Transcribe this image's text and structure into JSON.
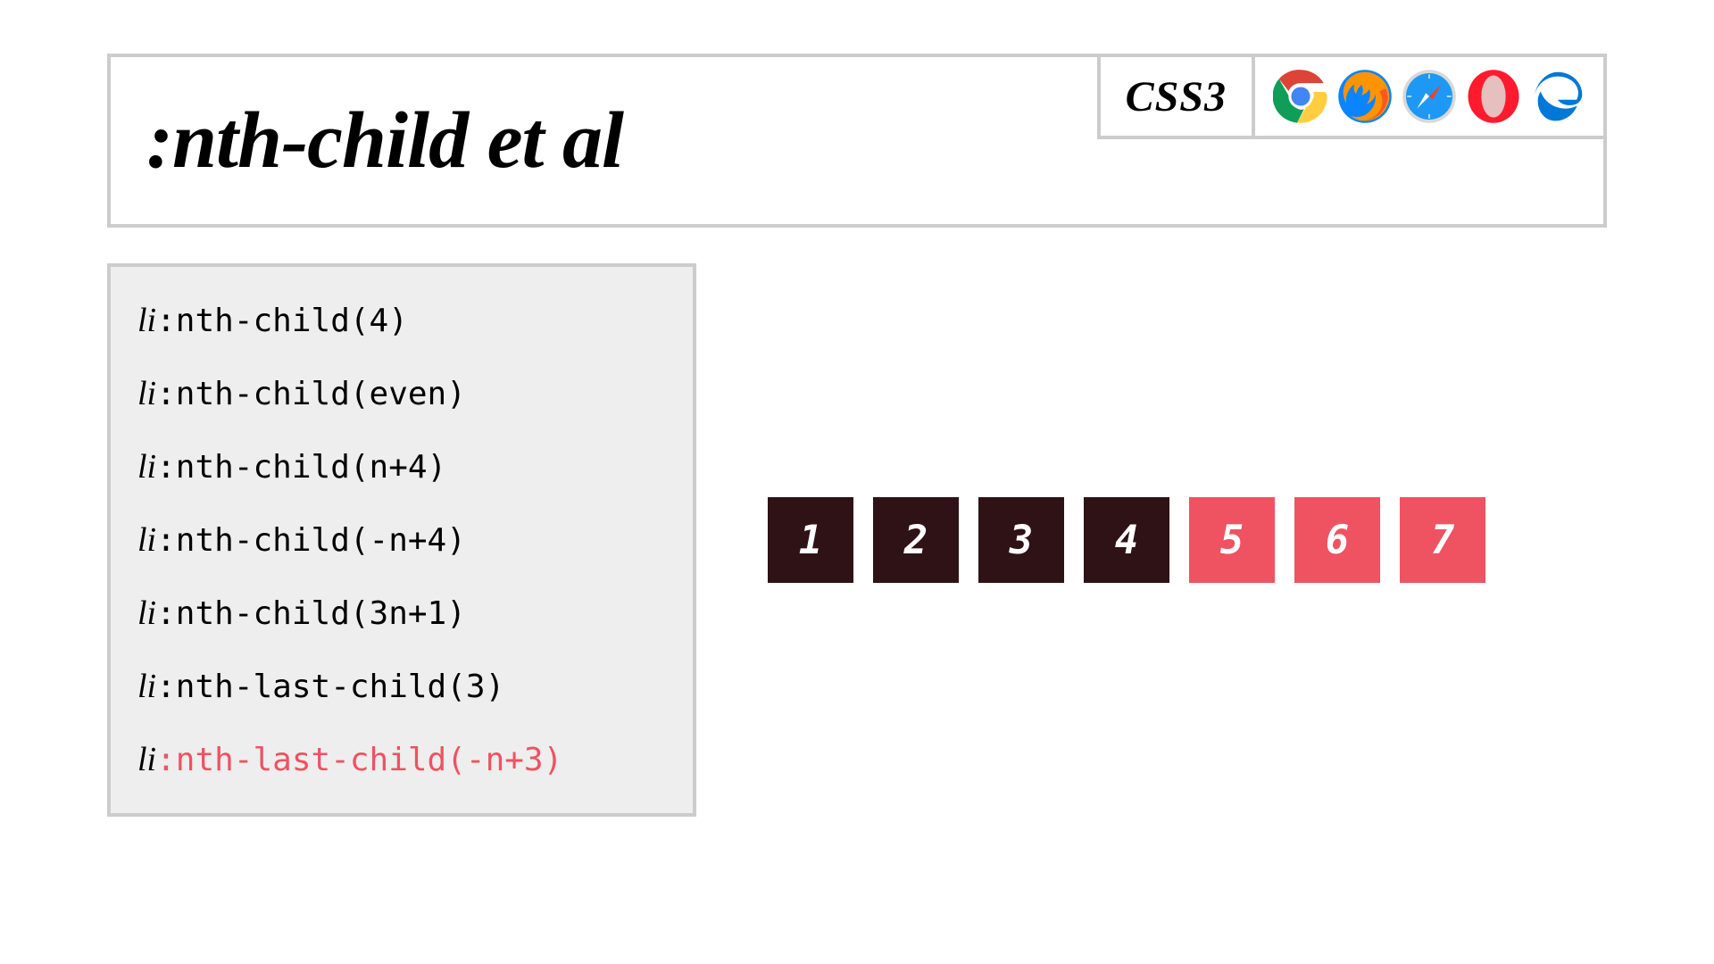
{
  "header": {
    "title": ":nth-child et al",
    "badge": "CSS3",
    "browsers": [
      "chrome",
      "firefox",
      "safari",
      "opera",
      "edge"
    ]
  },
  "code": {
    "element": "li",
    "lines": [
      {
        "pseudo": ":nth-child(4)",
        "active": false
      },
      {
        "pseudo": ":nth-child(even)",
        "active": false
      },
      {
        "pseudo": ":nth-child(n+4)",
        "active": false
      },
      {
        "pseudo": ":nth-child(-n+4)",
        "active": false
      },
      {
        "pseudo": ":nth-child(3n+1)",
        "active": false
      },
      {
        "pseudo": ":nth-last-child(3)",
        "active": false
      },
      {
        "pseudo": ":nth-last-child(-n+3)",
        "active": true
      }
    ]
  },
  "boxes": [
    {
      "label": "1",
      "selected": false
    },
    {
      "label": "2",
      "selected": false
    },
    {
      "label": "3",
      "selected": false
    },
    {
      "label": "4",
      "selected": false
    },
    {
      "label": "5",
      "selected": true
    },
    {
      "label": "6",
      "selected": true
    },
    {
      "label": "7",
      "selected": true
    }
  ],
  "colors": {
    "dark": "#2e1216",
    "pink": "#ef5261",
    "panel_bg": "#eeeeee",
    "border": "#cccccc"
  }
}
